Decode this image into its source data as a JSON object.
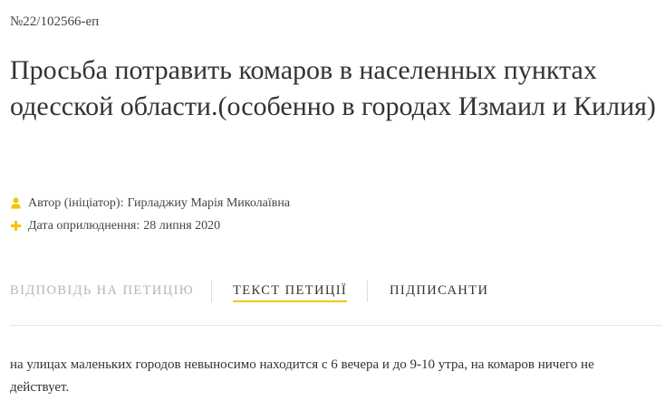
{
  "petition": {
    "number": "№22/102566-еп",
    "title": "Просьба потравить комаров в населенных пунктах одесской области.(особенно в городах Измаил и Килия)"
  },
  "meta": {
    "author_label": "Автор (ініціатор):",
    "author_value": "Гирладжиу Марія Миколаївна",
    "date_label": "Дата оприлюднення:",
    "date_value": "28 липня 2020"
  },
  "tabs": [
    {
      "label": "Відповідь на петицію",
      "state": "disabled"
    },
    {
      "label": "Текст петиції",
      "state": "active"
    },
    {
      "label": "Підписанти",
      "state": "default"
    }
  ],
  "body": {
    "text": "на улицах маленьких городов невыносимо находится с 6 вечера и до 9-10 утра, на комаров ничего не действует."
  },
  "colors": {
    "accent": "#f3c600",
    "text": "#333333",
    "muted": "#b5b5b5"
  },
  "icons": {
    "author": "user-icon",
    "date": "plus-icon"
  }
}
